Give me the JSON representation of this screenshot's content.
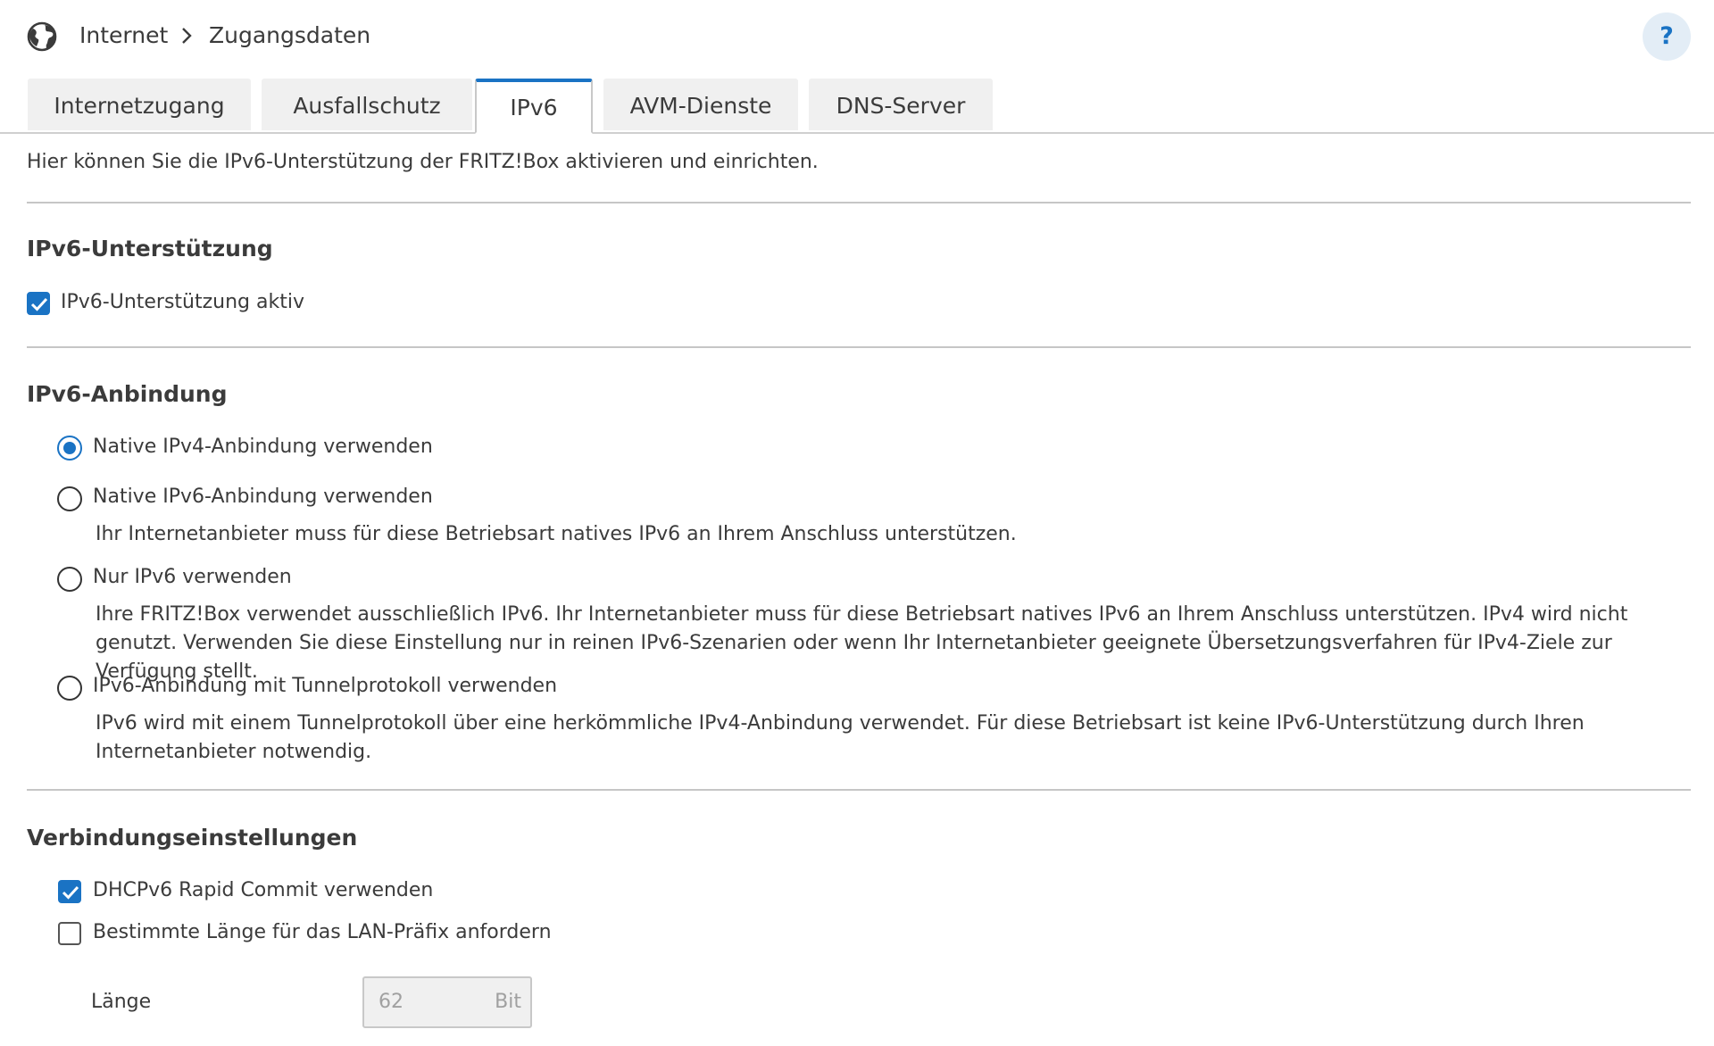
{
  "header": {
    "breadcrumb": [
      "Internet",
      "Zugangsdaten"
    ],
    "help_label": "?"
  },
  "tabs": [
    {
      "label": "Internetzugang",
      "active": false
    },
    {
      "label": "Ausfallschutz",
      "active": false
    },
    {
      "label": "IPv6",
      "active": true
    },
    {
      "label": "AVM-Dienste",
      "active": false
    },
    {
      "label": "DNS-Server",
      "active": false
    }
  ],
  "intro": "Hier können Sie die IPv6-Unterstützung der FRITZ!Box aktivieren und einrichten.",
  "ipv6_support": {
    "title": "IPv6-Unterstützung",
    "checkbox_label": "IPv6-Unterstützung aktiv",
    "checked": true
  },
  "ipv6_connection": {
    "title": "IPv6-Anbindung",
    "options": [
      {
        "label": "Native IPv4-Anbindung verwenden",
        "selected": true,
        "description": ""
      },
      {
        "label": "Native IPv6-Anbindung verwenden",
        "selected": false,
        "description": "Ihr Internetanbieter muss für diese Betriebsart natives IPv6 an Ihrem Anschluss unterstützen."
      },
      {
        "label": "Nur IPv6 verwenden",
        "selected": false,
        "description": "Ihre FRITZ!Box verwendet ausschließlich IPv6. Ihr Internetanbieter muss für diese Betriebsart natives IPv6 an Ihrem Anschluss unterstützen. IPv4 wird nicht genutzt. Verwenden Sie diese Einstellung nur in reinen IPv6-Szenarien oder wenn Ihr Internetanbieter geeignete Übersetzungsverfahren für IPv4-Ziele zur Verfügung stellt."
      },
      {
        "label": "IPv6-Anbindung mit Tunnelprotokoll verwenden",
        "selected": false,
        "description": "IPv6 wird mit einem Tunnelprotokoll über eine herkömmliche IPv4-Anbindung verwendet. Für diese Betriebsart ist keine IPv6-Unterstützung durch Ihren Internetanbieter notwendig."
      }
    ]
  },
  "connection_settings": {
    "title": "Verbindungseinstellungen",
    "rapid_commit": {
      "label": "DHCPv6 Rapid Commit verwenden",
      "checked": true
    },
    "prefix_length": {
      "label": "Bestimmte Länge für das LAN-Präfix anfordern",
      "checked": false
    },
    "length": {
      "label": "Länge",
      "value": "62",
      "unit": "Bit"
    }
  },
  "colors": {
    "accent": "#1a73c4",
    "text": "#3b3b3b",
    "divider": "#c6c6c6",
    "tab_bg": "#f0f0f0",
    "help_bg": "#e3edf6"
  }
}
